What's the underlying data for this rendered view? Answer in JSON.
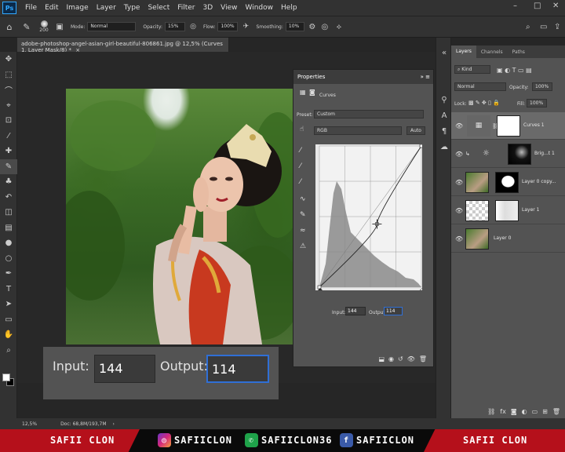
{
  "app": {
    "logo": "Ps"
  },
  "menubar": {
    "items": [
      "File",
      "Edit",
      "Image",
      "Layer",
      "Type",
      "Select",
      "Filter",
      "3D",
      "View",
      "Window",
      "Help"
    ]
  },
  "window_controls": {
    "minimize": "–",
    "maximize": "□",
    "close": "✕"
  },
  "options_bar": {
    "brush_size": "200",
    "mode_label": "Mode:",
    "mode_value": "Normal",
    "opacity_label": "Opacity:",
    "opacity_value": "15%",
    "flow_label": "Flow:",
    "flow_value": "100%",
    "smoothing_label": "Smoothing:",
    "smoothing_value": "10%"
  },
  "document_tab": {
    "title": "adobe-photoshop-angel-asian-girl-beautiful-806861.jpg @ 12,5% (Curves 1, Layer Mask/8) *",
    "close": "×"
  },
  "tools": [
    "move-icon",
    "marquee-icon",
    "lasso-icon",
    "quick-select-icon",
    "crop-icon",
    "eyedropper-icon",
    "healing-icon",
    "brush-icon",
    "clone-stamp-icon",
    "history-brush-icon",
    "eraser-icon",
    "gradient-icon",
    "blur-icon",
    "dodge-icon",
    "pen-icon",
    "type-icon",
    "path-select-icon",
    "rectangle-icon",
    "hand-icon",
    "zoom-icon"
  ],
  "tool_glyphs": [
    "✥",
    "⬚",
    "⌒",
    "⌖",
    "⊡",
    "⁄",
    "✚",
    "✎",
    "♣",
    "↶",
    "◫",
    "▤",
    "●",
    "○",
    "✒",
    "T",
    "➤",
    "▭",
    "✋",
    "⌕"
  ],
  "properties": {
    "tab": "Properties",
    "adjustment": "Curves",
    "preset_label": "Preset:",
    "preset_value": "Custom",
    "channel": "RGB",
    "auto": "Auto",
    "input_label": "Input:",
    "input_value": "144",
    "output_label": "Output:",
    "output_value": "114"
  },
  "zoom_overlay": {
    "input_label": "Input:",
    "input_value": "144",
    "output_label": "Output:",
    "output_value": "114"
  },
  "layers_panel": {
    "tabs": [
      "Layers",
      "Channels",
      "Paths"
    ],
    "filter_kind": "Kind",
    "blend_mode": "Normal",
    "opacity_label": "Opacity:",
    "opacity_value": "100%",
    "lock_label": "Lock:",
    "fill_label": "Fill:",
    "fill_value": "100%",
    "layers": [
      {
        "name": "Curves 1"
      },
      {
        "name": "Brig...t 1"
      },
      {
        "name": "Layer 0 copy..."
      },
      {
        "name": "Layer 1"
      },
      {
        "name": "Layer 0"
      }
    ]
  },
  "status_bar": {
    "zoom": "12,5%",
    "doc": "Doc: 68,8M/193,7M"
  },
  "banner": {
    "left": "SAFII CLON",
    "instagram": "SAFIICLON",
    "whatsapp": "SAFIICLON36",
    "facebook": "SAFIICLON",
    "right": "SAFII CLON"
  },
  "colors": {
    "accent": "#31a8ff",
    "banner_red": "#b5101b",
    "focus_blue": "#2f6fd6"
  },
  "chart_data": {
    "type": "line",
    "title": "",
    "x": [
      0,
      144,
      255
    ],
    "y": [
      0,
      114,
      255
    ],
    "xlim": [
      0,
      255
    ],
    "ylim": [
      0,
      255
    ],
    "grid": true,
    "control_point": {
      "input": 144,
      "output": 114
    }
  }
}
